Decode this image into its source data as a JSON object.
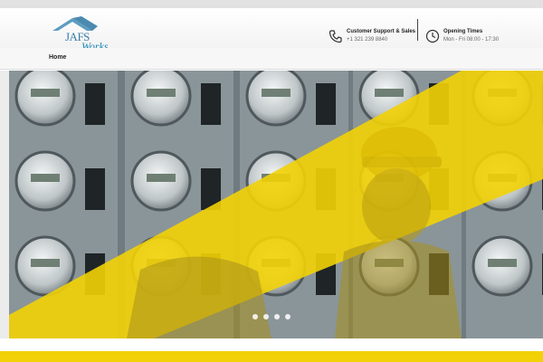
{
  "brand": {
    "logo_line1": "JAFS",
    "logo_line2": "Works"
  },
  "header": {
    "support": {
      "title": "Customer Support & Sales",
      "value": "+1 321 239 8840",
      "icon": "phone-icon"
    },
    "hours": {
      "title": "Opening Times",
      "value": "Mon - Fri 08:00 - 17:30",
      "icon": "clock-icon"
    }
  },
  "nav": {
    "items": [
      {
        "label": "Home"
      }
    ]
  },
  "hero": {
    "slides_count": 4,
    "active_slide": 1,
    "accent": "#f2d206"
  },
  "colors": {
    "accent_yellow": "#f2d206",
    "topbar_gray": "#e2e2e2",
    "text_dark": "#222222"
  }
}
